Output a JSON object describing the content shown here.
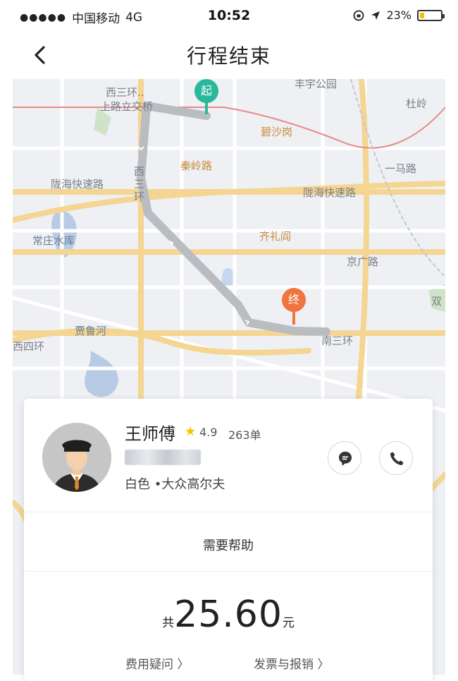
{
  "status_bar": {
    "carrier": "中国移动",
    "network": "4G",
    "time": "10:52",
    "battery": "23%",
    "battery_level": 0.23
  },
  "nav": {
    "title": "行程结束"
  },
  "map": {
    "labels": [
      {
        "text": "西三环..",
        "class": "ml-gray"
      },
      {
        "text": "上路立交桥",
        "class": "ml-gray"
      },
      {
        "text": "丰宇公园",
        "class": "ml-gray"
      },
      {
        "text": "杜岭",
        "class": "ml-gray"
      },
      {
        "text": "碧沙岗",
        "class": "ml-orange"
      },
      {
        "text": "秦岭路",
        "class": "ml-orange"
      },
      {
        "text": "一马路",
        "class": "ml-gray"
      },
      {
        "text": "陇海快速路",
        "class": "ml-gray"
      },
      {
        "text": "陇海快速路",
        "class": "ml-gray"
      },
      {
        "text": "常庄水库",
        "class": "ml-blue"
      },
      {
        "text": "齐礼阎",
        "class": "ml-orange"
      },
      {
        "text": "京广路",
        "class": "ml-gray"
      },
      {
        "text": "双",
        "class": "ml-gray"
      },
      {
        "text": "贾鲁河",
        "class": "ml-blue"
      },
      {
        "text": "西四环",
        "class": "ml-gray"
      },
      {
        "text": "南三环",
        "class": "ml-gray"
      },
      {
        "text": "西三环",
        "class": "ml-gray"
      }
    ],
    "start_marker": "起",
    "end_marker": "终"
  },
  "driver": {
    "name": "王师傅",
    "rating": "4.9",
    "orders": "263单",
    "car": "白色 •大众高尔夫"
  },
  "help": "需要帮助",
  "fare": {
    "prefix": "共",
    "amount": "25.60",
    "unit": "元"
  },
  "links": {
    "fee_question": "费用疑问 〉",
    "invoice": "发票与报销 〉"
  },
  "colors": {
    "accent": "#f5c200",
    "route": "#b9bcc1",
    "start_marker": "#29b89a",
    "end_marker": "#f0743e"
  }
}
